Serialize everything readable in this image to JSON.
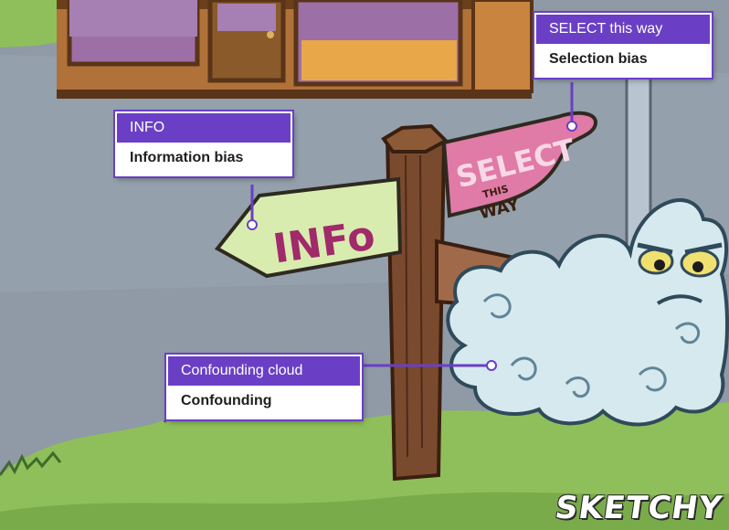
{
  "callouts": {
    "info": {
      "title": "INFO",
      "label": "Information bias"
    },
    "select": {
      "title": "SELECT this way",
      "label": "Selection bias"
    },
    "confounding": {
      "title": "Confounding cloud",
      "label": "Confounding"
    }
  },
  "signs": {
    "info_text": "INFo",
    "select_text": "SELECT",
    "select_sub_1": "THIS",
    "select_sub_2": "WAY"
  },
  "brand": "SKETCHY",
  "colors": {
    "accent": "#6a3fc6",
    "road": "#8f9aa6",
    "grass": "#8fbf5a",
    "sign_info": "#d9ecb0",
    "sign_select": "#e07aa6",
    "post": "#7a4a2e",
    "cloud": "#d6e9ef"
  }
}
